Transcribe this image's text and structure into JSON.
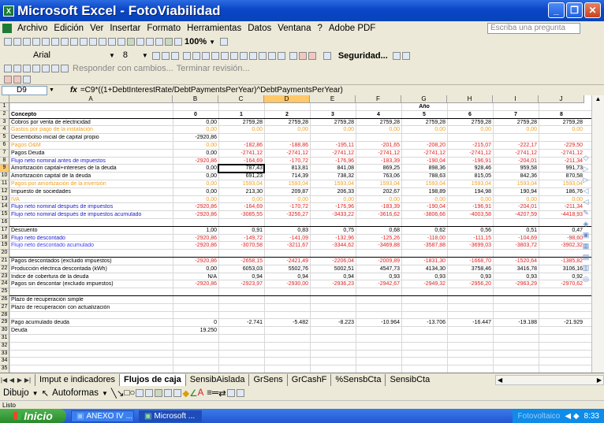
{
  "window": {
    "title": "Microsoft Excel - FotoViabilidad",
    "app_icon": "X"
  },
  "menu": {
    "items": [
      "Archivo",
      "Edición",
      "Ver",
      "Insertar",
      "Formato",
      "Herramientas",
      "Datos",
      "Ventana",
      "?",
      "Adobe PDF"
    ],
    "ask_placeholder": "Escriba una pregunta"
  },
  "toolbar": {
    "zoom": "100%",
    "font_name": "Arial",
    "font_size": "8",
    "security": "Seguridad...",
    "reply_label": "Responder con cambios...",
    "end_review": "Terminar revisión..."
  },
  "formula_bar": {
    "cell_ref": "D9",
    "fx": "fx",
    "formula": "=C9*((1+DebtInterestRate/DebtPaymentsPerYear)^DebtPaymentsPerYear)"
  },
  "columns": [
    "A",
    "B",
    "C",
    "D",
    "E",
    "F",
    "G",
    "H",
    "I",
    "J"
  ],
  "rows": [
    {
      "n": "1",
      "label": "",
      "vals": [
        "",
        "",
        "",
        "",
        "",
        "Año",
        "",
        "",
        ""
      ]
    },
    {
      "n": "2",
      "label": "Concepto",
      "vals": [
        "0",
        "1",
        "2",
        "3",
        "4",
        "5",
        "6",
        "7",
        "8"
      ]
    },
    {
      "n": "3",
      "label": "Cobros por venta de electricidad",
      "vals": [
        "0,00",
        "2759,28",
        "2759,28",
        "2759,28",
        "2759,28",
        "2759,28",
        "2759,28",
        "2759,28",
        "2759,28"
      ]
    },
    {
      "n": "4",
      "label": "Gastos por pago de la instalación",
      "vals": [
        "0,00",
        "0,00",
        "0,00",
        "0,00",
        "0,00",
        "0,00",
        "0,00",
        "0,00",
        "0,00"
      ]
    },
    {
      "n": "5",
      "label": "Desembolso inicial de capital propio",
      "vals": [
        "-2920,86",
        "",
        "",
        "",
        "",
        "",
        "",
        "",
        ""
      ]
    },
    {
      "n": "6",
      "label": "Pagos O&M",
      "vals": [
        "0,00",
        "-182,86",
        "-188,86",
        "-195,11",
        "-201,65",
        "-208,20",
        "-215,07",
        "-222,17",
        "-229,50"
      ]
    },
    {
      "n": "7",
      "label": "Pagos Deuda",
      "vals": [
        "0,00",
        "-2741,12",
        "-2741,12",
        "-2741,12",
        "-2741,12",
        "-2741,12",
        "-2741,12",
        "-2741,12",
        "-2741,12"
      ]
    },
    {
      "n": "8",
      "label": "Flujo neto nominal antes de impuestos",
      "vals": [
        "-2920,86",
        "-164,69",
        "-170,72",
        "-176,96",
        "-183,39",
        "-190,04",
        "-196,91",
        "-204,01",
        "-211,34"
      ]
    },
    {
      "n": "9",
      "label": "Amortización capital+intereses de la deuda",
      "vals": [
        "0,00",
        "787,43",
        "813,81",
        "841,08",
        "869,25",
        "898,36",
        "928,46",
        "959,58",
        "991,73"
      ]
    },
    {
      "n": "10",
      "label": "Amortización capital de la deuda",
      "vals": [
        "0,00",
        "691,23",
        "714,39",
        "738,32",
        "763,06",
        "788,63",
        "815,05",
        "842,36",
        "870,58"
      ]
    },
    {
      "n": "11",
      "label": "Pagos por amortización de la inversión",
      "vals": [
        "0,00",
        "1593,04",
        "1593,04",
        "1593,04",
        "1593,04",
        "1593,04",
        "1593,04",
        "1593,04",
        "1593,04"
      ]
    },
    {
      "n": "12",
      "label": "Impuesto de sociedades",
      "vals": [
        "0,00",
        "213,30",
        "209,87",
        "206,33",
        "202,67",
        "198,89",
        "194,98",
        "190,94",
        "186,76"
      ]
    },
    {
      "n": "13",
      "label": "IVA",
      "vals": [
        "0,00",
        "0,00",
        "0,00",
        "0,00",
        "0,00",
        "0,00",
        "0,00",
        "0,00",
        "0,00"
      ]
    },
    {
      "n": "14",
      "label": "Flujo neto nominal después de impuestos",
      "vals": [
        "-2920,86",
        "-164,69",
        "-170,72",
        "-176,96",
        "-183,39",
        "-190,04",
        "-196,91",
        "-204,01",
        "-211,34"
      ]
    },
    {
      "n": "15",
      "label": "Flujo neto nominal después de impuestos acumulado",
      "vals": [
        "-2920,86",
        "-3085,55",
        "-3256,27",
        "-3433,22",
        "-3616,62",
        "-3806,66",
        "-4003,58",
        "-4207,59",
        "-4418,93"
      ]
    },
    {
      "n": "16",
      "label": "",
      "vals": [
        "",
        "",
        "",
        "",
        "",
        "",
        "",
        "",
        ""
      ]
    },
    {
      "n": "17",
      "label": "Descuento",
      "vals": [
        "1,00",
        "0,91",
        "0,83",
        "0,75",
        "0,68",
        "0,62",
        "0,56",
        "0,51",
        "0,47"
      ]
    },
    {
      "n": "18",
      "label": "Flujo neto descontado",
      "vals": [
        "-2920,86",
        "-149,72",
        "-141,09",
        "-132,96",
        "-125,26",
        "-118,00",
        "-111,15",
        "-104,69",
        "-98,60"
      ]
    },
    {
      "n": "19",
      "label": "Flujo neto descontado acumulado",
      "vals": [
        "-2920,86",
        "-3070,58",
        "-3211,67",
        "-3344,62",
        "-3469,88",
        "-3587,88",
        "-3699,03",
        "-3803,72",
        "-3902,32"
      ]
    },
    {
      "n": "20",
      "label": "",
      "vals": [
        "",
        "",
        "",
        "",
        "",
        "",
        "",
        "",
        ""
      ]
    },
    {
      "n": "21",
      "label": "Pagos descontados (excluido impuestos)",
      "vals": [
        "-2920,86",
        "-2658,15",
        "-2421,49",
        "-2206,04",
        "-2009,89",
        "-1831,30",
        "-1668,70",
        "-1520,64",
        "-1385,82"
      ]
    },
    {
      "n": "22",
      "label": "Producción eléctrica descontada (kWh)",
      "vals": [
        "0,00",
        "6053,03",
        "5502,76",
        "5002,51",
        "4547,73",
        "4134,30",
        "3758,46",
        "3416,78",
        "3106,16"
      ]
    },
    {
      "n": "23",
      "label": "Índice de cobertura de la deuda",
      "vals": [
        "N/A",
        "0,94",
        "0,94",
        "0,94",
        "0,93",
        "0,93",
        "0,93",
        "0,93",
        "0,92"
      ]
    },
    {
      "n": "24",
      "label": "Pagos sin descontar (excluido impuestos)",
      "vals": [
        "-2920,86",
        "-2923,97",
        "-2930,00",
        "-2936,23",
        "-2942,67",
        "-2949,32",
        "-2956,20",
        "-2963,29",
        "-2970,62"
      ]
    },
    {
      "n": "25",
      "label": "",
      "vals": [
        "",
        "",
        "",
        "",
        "",
        "",
        "",
        "",
        ""
      ]
    },
    {
      "n": "26",
      "label": "Plazo de recuperación simple",
      "vals": [
        "",
        "",
        "",
        "",
        "",
        "",
        "",
        "",
        ""
      ]
    },
    {
      "n": "27",
      "label": "Plazo de recuperación con actualización",
      "vals": [
        "",
        "",
        "",
        "",
        "",
        "",
        "",
        "",
        ""
      ]
    },
    {
      "n": "28",
      "label": "",
      "vals": [
        "",
        "",
        "",
        "",
        "",
        "",
        "",
        "",
        ""
      ]
    },
    {
      "n": "29",
      "label": "Pago acumulado deuda",
      "vals": [
        "0",
        "-2.741",
        "-5.482",
        "-8.223",
        "-10.964",
        "-13.706",
        "-16.447",
        "-19.188",
        "-21.929"
      ]
    },
    {
      "n": "30",
      "label": "Deuda",
      "vals": [
        "19.250",
        "",
        "",
        "",
        "",
        "",
        "",
        "",
        ""
      ]
    },
    {
      "n": "31",
      "label": "",
      "vals": [
        "",
        "",
        "",
        "",
        "",
        "",
        "",
        "",
        ""
      ]
    },
    {
      "n": "32",
      "label": "",
      "vals": [
        "",
        "",
        "",
        "",
        "",
        "",
        "",
        "",
        ""
      ]
    },
    {
      "n": "33",
      "label": "",
      "vals": [
        "",
        "",
        "",
        "",
        "",
        "",
        "",
        "",
        ""
      ]
    },
    {
      "n": "34",
      "label": "",
      "vals": [
        "",
        "",
        "",
        "",
        "",
        "",
        "",
        "",
        ""
      ]
    },
    {
      "n": "35",
      "label": "",
      "vals": [
        "",
        "",
        "",
        "",
        "",
        "",
        "",
        "",
        ""
      ]
    }
  ],
  "row_styles": {
    "4": "#f0a020",
    "6": "#f0a020",
    "11": "#f0a020",
    "13": "#f0a020",
    "8": "#2020d0",
    "14": "#2020d0",
    "15": "#2020d0",
    "18": "#2020d0",
    "19": "#4040ff",
    "neg": "#e02020"
  },
  "sheet_tabs": [
    "Imput e indicadores",
    "Flujos de caja",
    "SensibAislada",
    "GrSens",
    "GrCashF",
    "%SensbCta",
    "SensibCta"
  ],
  "active_tab": "Flujos de caja",
  "draw_toolbar": {
    "draw": "Dibujo",
    "autoshapes": "Autoformas"
  },
  "status": "Listo",
  "taskbar": {
    "start": "Inicio",
    "tasks": [
      "ANEXO IV ...",
      "Microsoft ..."
    ],
    "tray_hint": "Fotovoltaico",
    "clock": "8:33"
  }
}
